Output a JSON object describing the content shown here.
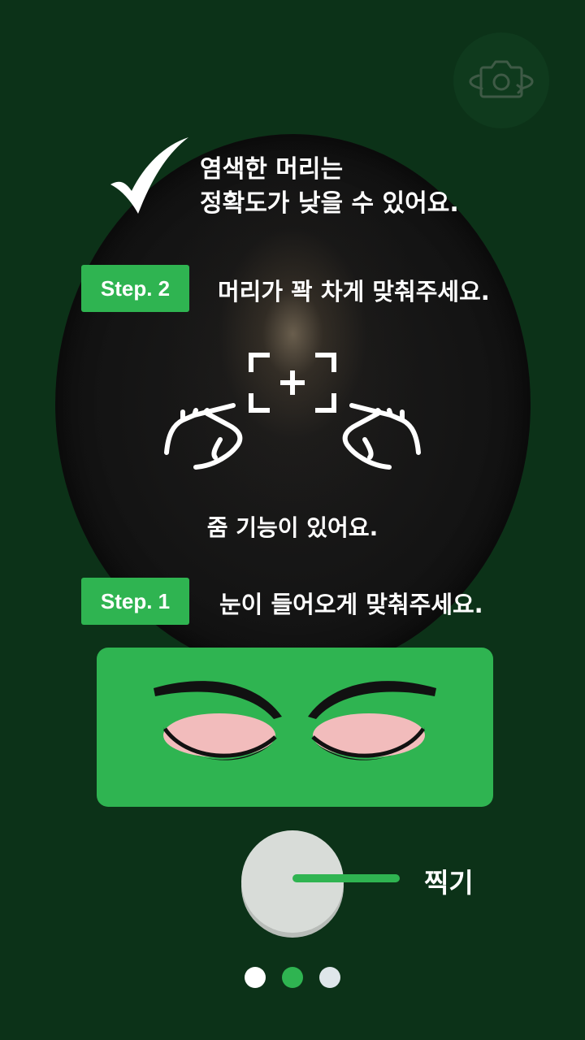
{
  "warning": {
    "line1": "염색한 머리는",
    "line2": "정확도가 낮을 수 있어요."
  },
  "step2": {
    "badge": "Step. 2",
    "instruction": "머리가 꽉 차게 맞춰주세요."
  },
  "zoom": {
    "label": "줌 기능이 있어요."
  },
  "step1": {
    "badge": "Step. 1",
    "instruction": "눈이 들어오게 맞춰주세요."
  },
  "shutter": {
    "label": "찍기"
  },
  "icons": {
    "camera_switch": "camera-switch-icon",
    "check": "check-mark-icon",
    "zoom_frame": "zoom-frame-icon",
    "pinch_left": "pinch-hand-left-icon",
    "pinch_right": "pinch-hand-right-icon"
  },
  "pagination": {
    "count": 3,
    "active_index": 1
  },
  "colors": {
    "background": "#0c3218",
    "accent": "#2fb451",
    "eyelid": "#f2bcbc",
    "dot_inactive_1": "#ffffff",
    "dot_inactive_2": "#dfe6ea"
  }
}
